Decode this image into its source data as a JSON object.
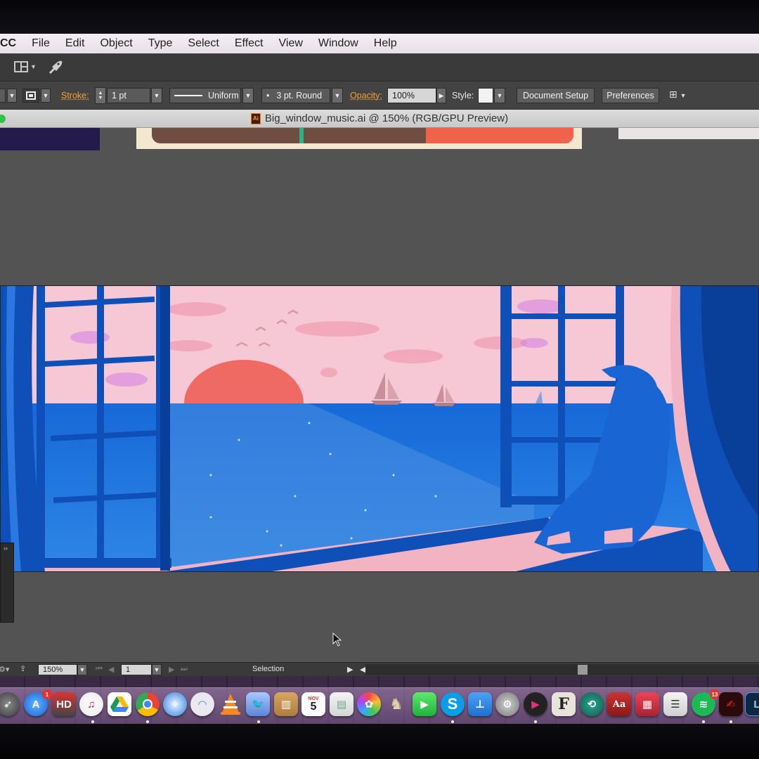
{
  "menubar": {
    "app_name": "CC",
    "items": [
      "File",
      "Edit",
      "Object",
      "Type",
      "Select",
      "Effect",
      "View",
      "Window",
      "Help"
    ]
  },
  "control_bar": {
    "stroke_label": "Stroke:",
    "stroke_weight": "1 pt",
    "stroke_profile": "Uniform",
    "brush": "3 pt. Round",
    "opacity_label": "Opacity:",
    "opacity_value": "100%",
    "style_label": "Style:",
    "document_setup_label": "Document Setup",
    "preferences_label": "Preferences"
  },
  "document": {
    "tab_title": "Big_window_music.ai @ 150% (RGB/GPU Preview)",
    "file_icon_text": "Ai"
  },
  "status_bar": {
    "zoom": "150%",
    "artboard_number": "1",
    "tool_name": "Selection"
  },
  "dock": {
    "app_store_badge": "1",
    "spotify_badge": "13",
    "calendar_month": "NOV",
    "calendar_day": "5"
  },
  "colors": {
    "sky": "#f6c7d5",
    "sea": "#1f73d6",
    "frame": "#0e4fb8",
    "sun": "#ef6a63"
  }
}
